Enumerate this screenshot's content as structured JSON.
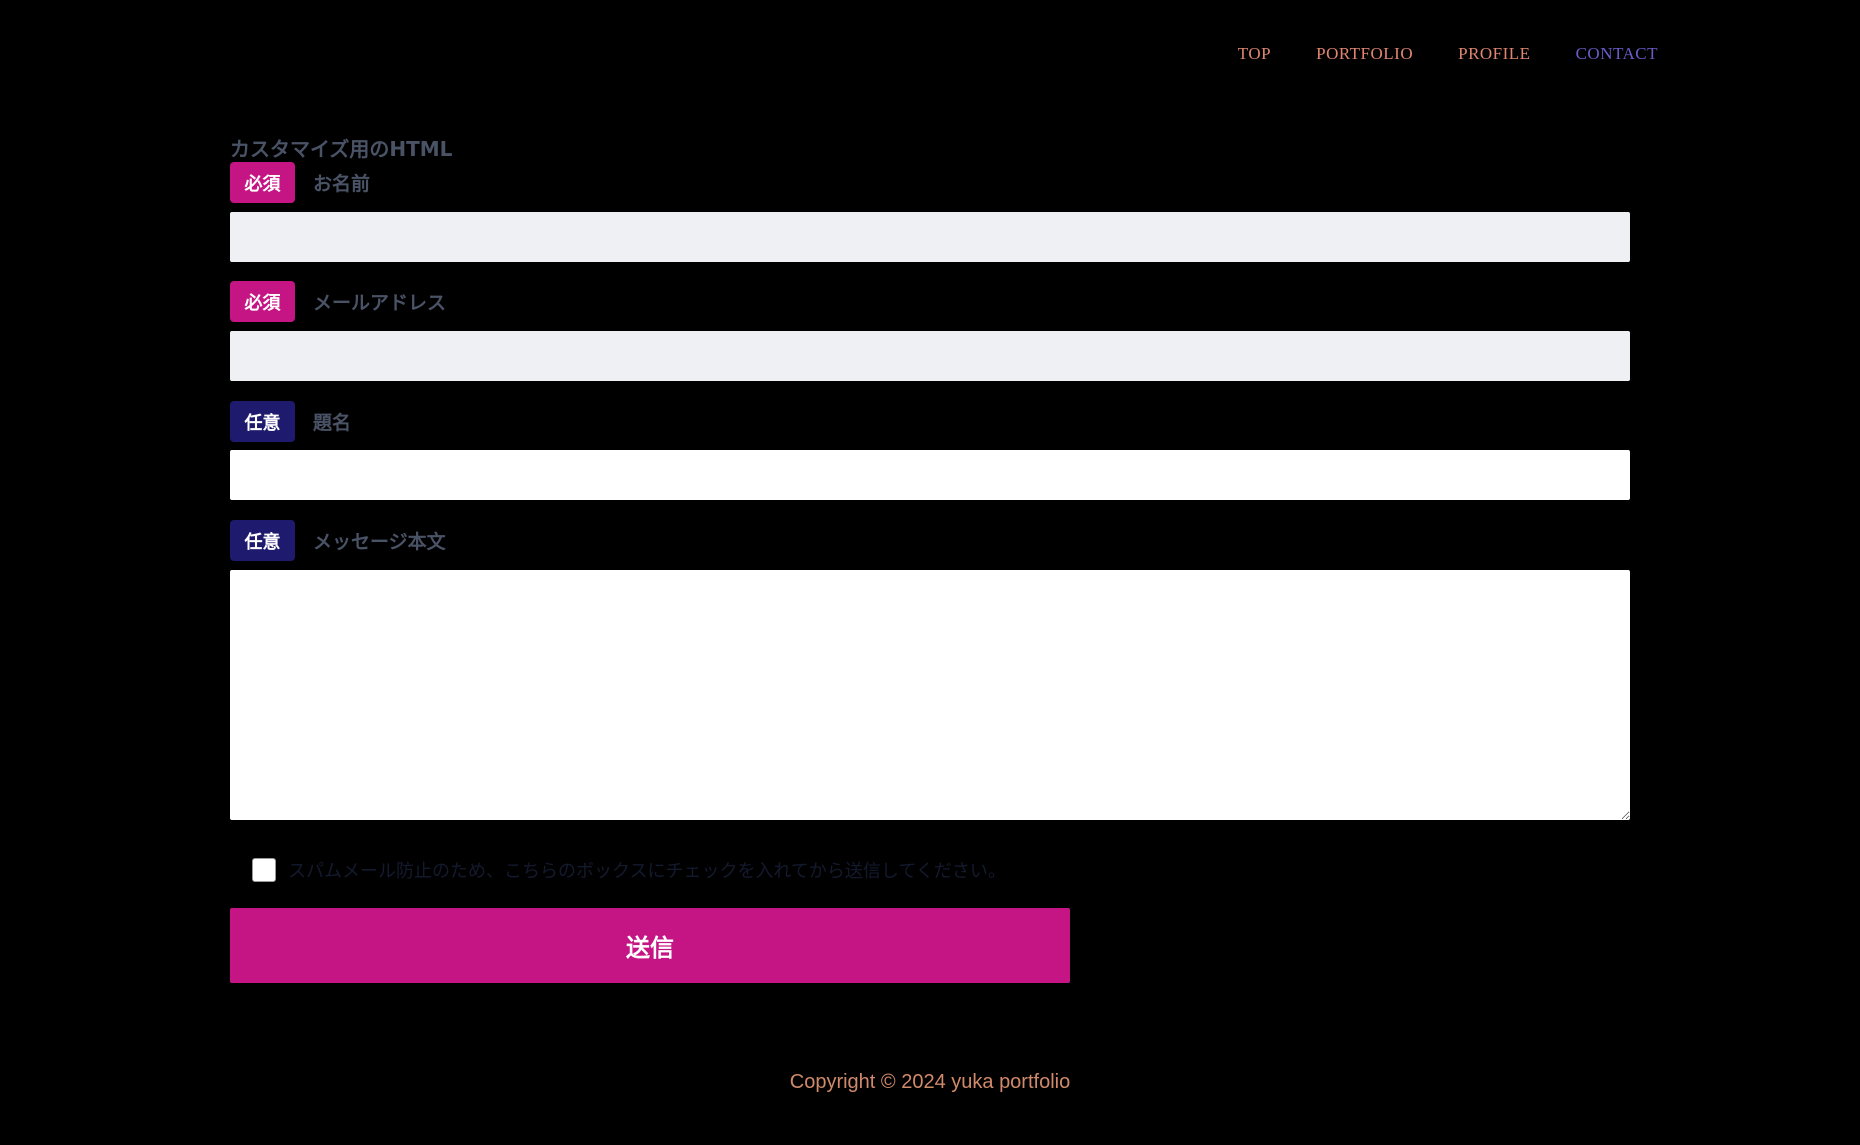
{
  "nav": {
    "items": [
      {
        "label": "TOP"
      },
      {
        "label": "PORTFOLIO"
      },
      {
        "label": "PROFILE"
      },
      {
        "label": "CONTACT"
      }
    ],
    "active": "CONTACT"
  },
  "form": {
    "heading": "カスタマイズ用のHTML",
    "fields": [
      {
        "badge": "必須",
        "label": "お名前",
        "value": ""
      },
      {
        "badge": "必須",
        "label": "メールアドレス",
        "value": ""
      },
      {
        "badge": "任意",
        "label": "題名",
        "value": ""
      },
      {
        "badge": "任意",
        "label": "メッセージ本文",
        "value": ""
      }
    ],
    "spam_check": {
      "label": "スパムメール防止のため、こちらのボックスにチェックを入れてから送信してください。",
      "checked": false
    },
    "submit_label": "送信"
  },
  "footer": {
    "copyright": "Copyright © 2024 yuka portfolio"
  },
  "colors": {
    "background": "#000000",
    "required_badge": "#c51584",
    "optional_badge": "#1e1a6e",
    "nav_link": "#e08670",
    "nav_active": "#6a5cc9",
    "submit": "#c51584"
  }
}
